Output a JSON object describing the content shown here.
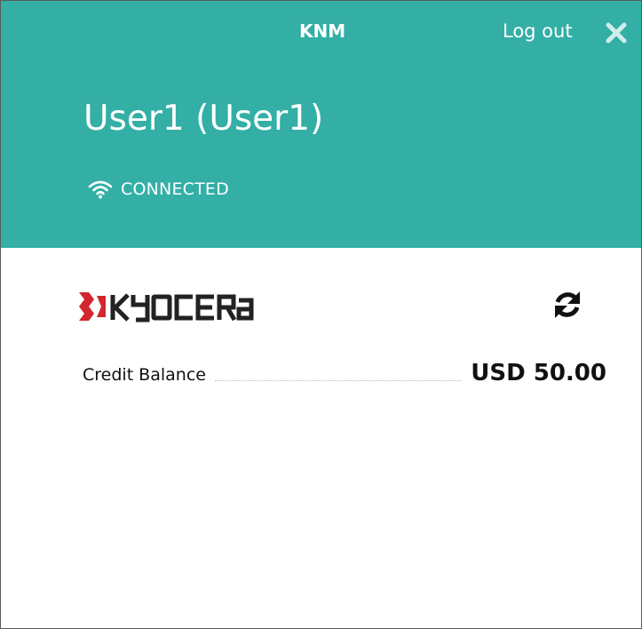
{
  "header": {
    "app_name": "KNM",
    "logout_label": "Log out",
    "user_title": "User1 (User1)",
    "status_text": "CONNECTED",
    "background_color": "#33afa6"
  },
  "brand": {
    "logo_text": "KYOCERA",
    "logo_mark_color": "#d3262e"
  },
  "balance": {
    "label": "Credit Balance",
    "value": "USD 50.00"
  },
  "icons": {
    "close": "close-icon",
    "wifi": "wifi-icon",
    "refresh": "refresh-icon"
  }
}
